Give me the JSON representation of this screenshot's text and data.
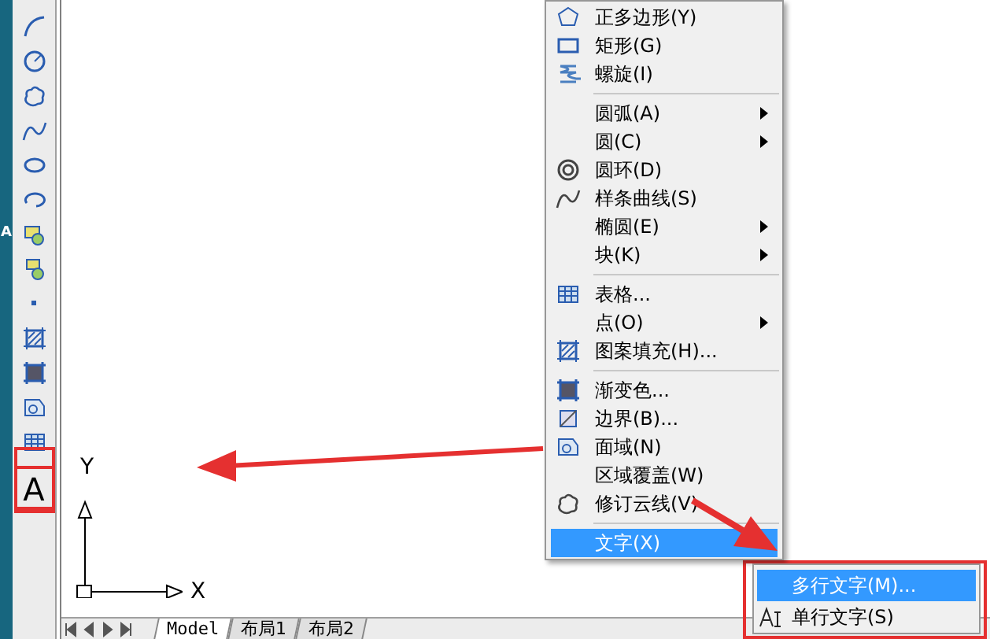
{
  "desktop": {
    "label": "A"
  },
  "toolbar": {
    "text_tool": {
      "label": "A",
      "selected": true
    }
  },
  "menu": [
    {
      "kind": "item",
      "label": "正多边形(Y)",
      "submenu": false,
      "selected": false
    },
    {
      "kind": "item",
      "label": "矩形(G)",
      "submenu": false,
      "selected": false
    },
    {
      "kind": "item",
      "label": "螺旋(I)",
      "submenu": false,
      "selected": false
    },
    {
      "kind": "separator"
    },
    {
      "kind": "item",
      "label": "圆弧(A)",
      "submenu": true,
      "selected": false
    },
    {
      "kind": "item",
      "label": "圆(C)",
      "submenu": true,
      "selected": false
    },
    {
      "kind": "item",
      "label": "圆环(D)",
      "submenu": false,
      "selected": false
    },
    {
      "kind": "item",
      "label": "样条曲线(S)",
      "submenu": false,
      "selected": false
    },
    {
      "kind": "item",
      "label": "椭圆(E)",
      "submenu": true,
      "selected": false
    },
    {
      "kind": "item",
      "label": "块(K)",
      "submenu": true,
      "selected": false
    },
    {
      "kind": "separator"
    },
    {
      "kind": "item",
      "label": "表格...",
      "submenu": false,
      "selected": false
    },
    {
      "kind": "item",
      "label": "点(O)",
      "submenu": true,
      "selected": false
    },
    {
      "kind": "item",
      "label": "图案填充(H)...",
      "submenu": false,
      "selected": false
    },
    {
      "kind": "separator"
    },
    {
      "kind": "item",
      "label": "渐变色...",
      "submenu": false,
      "selected": false
    },
    {
      "kind": "item",
      "label": "边界(B)...",
      "submenu": false,
      "selected": false
    },
    {
      "kind": "item",
      "label": "面域(N)",
      "submenu": false,
      "selected": false
    },
    {
      "kind": "item",
      "label": "区域覆盖(W)",
      "submenu": false,
      "selected": false
    },
    {
      "kind": "item",
      "label": "修订云线(V)",
      "submenu": false,
      "selected": false
    },
    {
      "kind": "separator"
    },
    {
      "kind": "item",
      "label": "文字(X)",
      "submenu": false,
      "selected": true
    }
  ],
  "submenu": [
    {
      "label": "多行文字(M)...",
      "selected": true
    },
    {
      "label": "单行文字(S)",
      "selected": false
    }
  ],
  "ucs": {
    "x_label": "X",
    "y_label": "Y"
  },
  "layout_tabs": [
    {
      "label": "Model",
      "selected": true
    },
    {
      "label": "布局1",
      "selected": false
    },
    {
      "label": "布局2",
      "selected": false
    }
  ]
}
